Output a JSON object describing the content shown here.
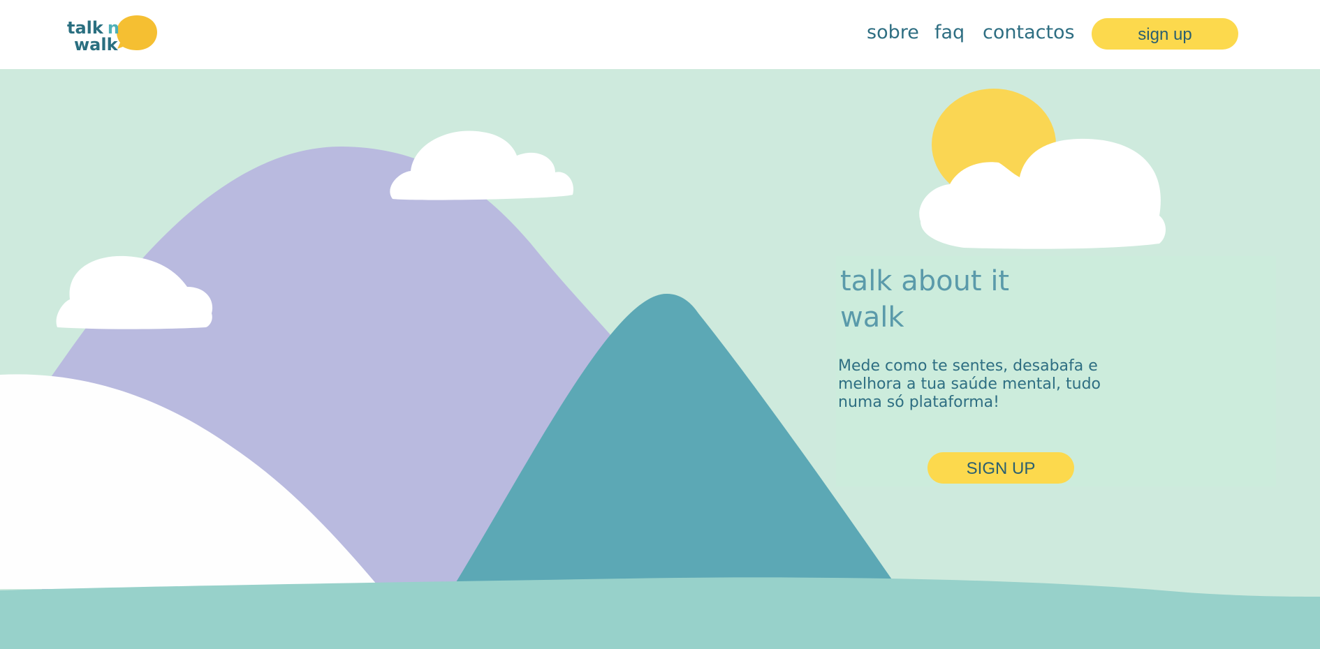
{
  "logo": {
    "line1": "talk",
    "line1_accent": "n",
    "line2": "walk"
  },
  "nav": {
    "items": [
      "sobre",
      "faq",
      "contactos"
    ],
    "signup_label": "sign up"
  },
  "hero": {
    "title": "talk about it\nwalk",
    "description": "Mede como te sentes, desabafa e melhora a tua saúde mental, tudo numa só plataforma!",
    "signup_label": "SIGN UP"
  },
  "colors": {
    "brand_teal": "#2e6e82",
    "accent_yellow": "#fcd94d",
    "background_mint": "#ceeadd",
    "mountain_lavender": "#b9badf",
    "mountain_teal": "#5ca8b5",
    "ground": "#97d1ca"
  }
}
